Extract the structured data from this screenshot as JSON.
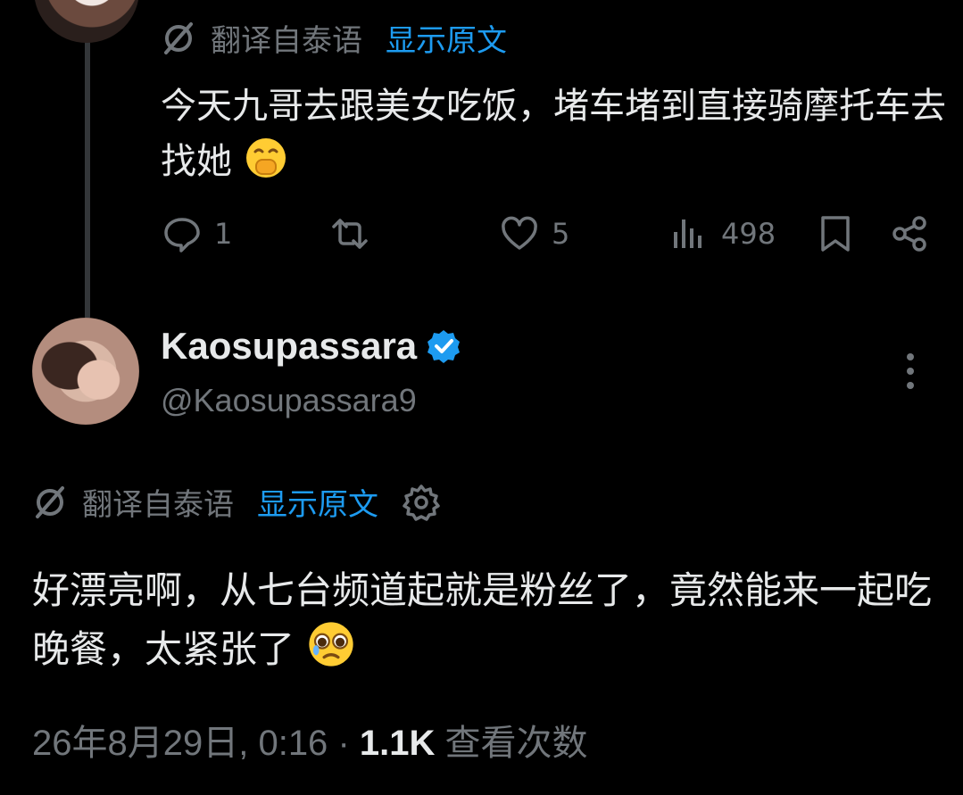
{
  "colors": {
    "background": "#000000",
    "text": "#e7e9ea",
    "muted": "#71767b",
    "link": "#1d9bf0",
    "verified": "#1d9bf0"
  },
  "reply": {
    "translate_label": "翻译自泰语",
    "show_original": "显示原文",
    "text": "今天九哥去跟美女吃饭，堵车堵到直接骑摩托车去找她",
    "emoji_icon": "hand-over-mouth-emoji",
    "actions": {
      "replies": "1",
      "likes": "5",
      "views": "498"
    }
  },
  "main": {
    "author_name": "Kaosupassara",
    "author_handle": "@Kaosupassara9",
    "translate_label": "翻译自泰语",
    "show_original": "显示原文",
    "text": "好漂亮啊，从七台频道起就是粉丝了，竟然能来一起吃晚餐，太紧张了",
    "emoji_icon": "pleading-face-emoji",
    "date": "26年8月29日, 0:16",
    "separator": "·",
    "views_count": "1.1K",
    "views_label": "查看次数"
  }
}
